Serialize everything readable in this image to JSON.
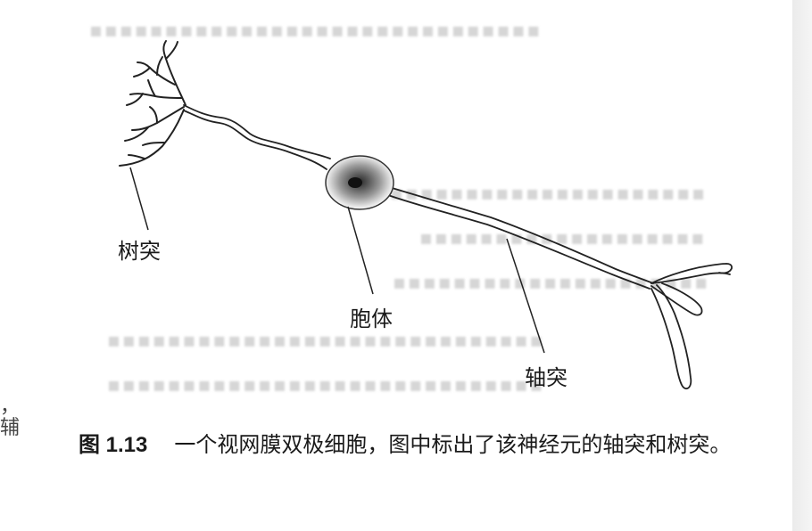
{
  "diagram": {
    "labels": {
      "dendrite": "树突",
      "soma": "胞体",
      "axon": "轴突"
    }
  },
  "margin_fragments": {
    "line1": "，",
    "line2": "辅"
  },
  "caption": {
    "figure_number": "图 1.13",
    "text": "一个视网膜双极细胞，图中标出了该神经元的轴突和树突。"
  }
}
